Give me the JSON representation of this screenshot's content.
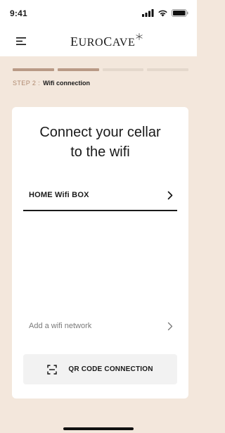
{
  "status_bar": {
    "time": "9:41",
    "icons": [
      "signal-icon",
      "wifi-icon",
      "battery-icon"
    ]
  },
  "header": {
    "menu_icon": "hamburger-menu-icon",
    "logo_text": "EUROCAVE",
    "logo_text_first": "E",
    "logo_text_mid": "URO",
    "logo_text_c": "C",
    "logo_text_rest": "AVE",
    "logo_icon": "snowflake-icon"
  },
  "progress": {
    "total_steps": 4,
    "completed_steps": 2,
    "active_color": "#b99a86",
    "inactive_color": "#e4d8cc"
  },
  "step": {
    "label": "STEP 2 :",
    "name": "Wifi connection"
  },
  "card": {
    "title_line1": "Connect your cellar",
    "title_line2": "to the wifi",
    "selected_network": "HOME Wifi BOX",
    "add_network_label": "Add a wifi network",
    "qr_button_label": "QR CODE CONNECTION",
    "qr_icon": "qr-scan-icon",
    "chevron_icon": "chevron-right-icon"
  },
  "colors": {
    "background": "#f3e7dc",
    "card": "#ffffff",
    "accent": "#b08a70"
  }
}
